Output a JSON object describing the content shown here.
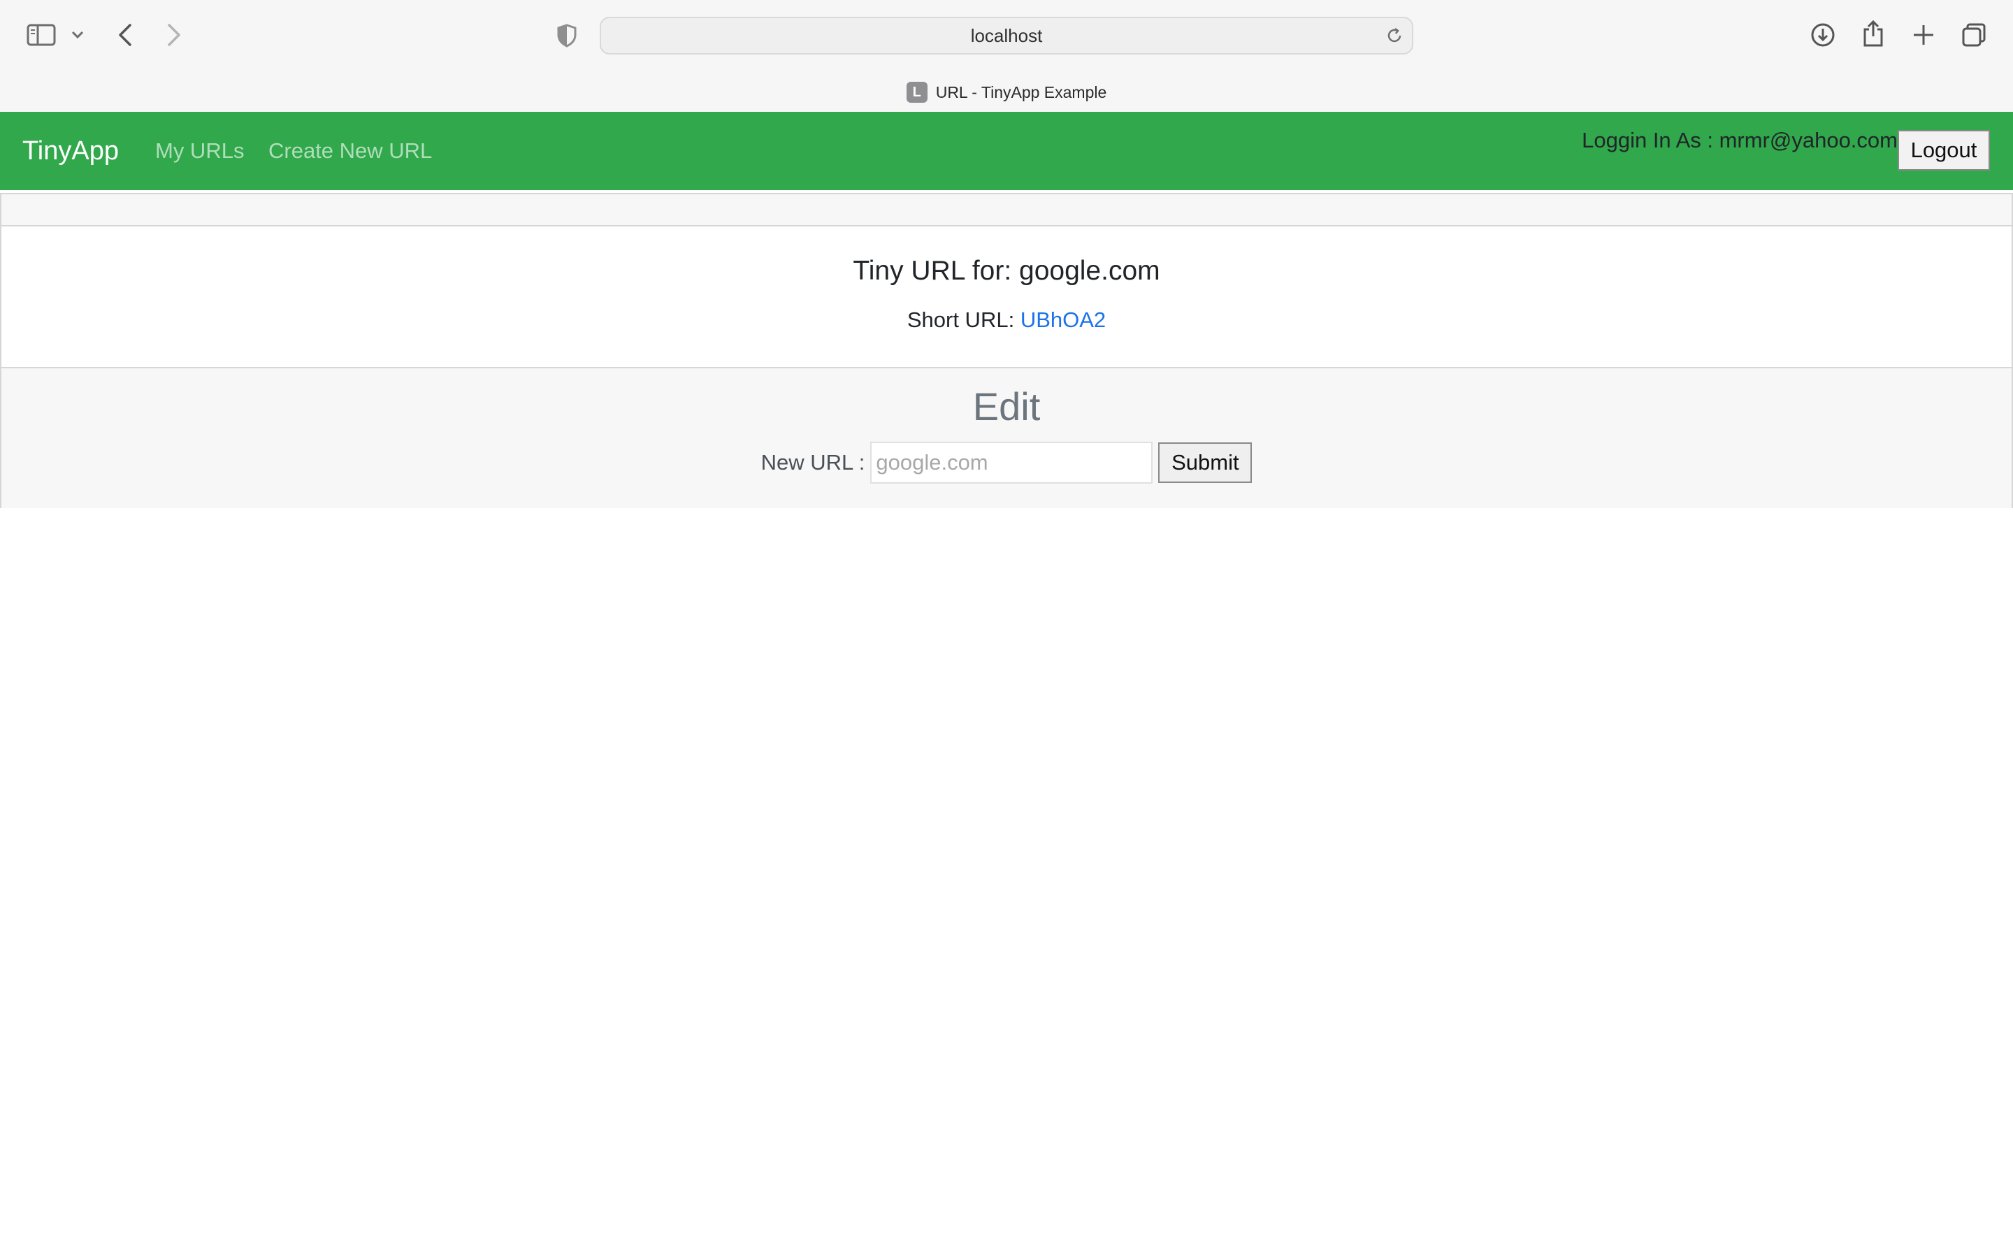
{
  "browser": {
    "address": "localhost",
    "tab_title": "URL - TinyApp Example",
    "favicon_letter": "L",
    "icons": [
      "sidebar-icon",
      "chevron-down-icon",
      "back-icon",
      "forward-icon",
      "shield-icon",
      "reload-icon",
      "download-icon",
      "share-icon",
      "new-tab-icon",
      "tabs-overview-icon"
    ]
  },
  "navbar": {
    "brand": "TinyApp",
    "links": [
      "My URLs",
      "Create New URL"
    ],
    "login_label": "Loggin In As : mrmr@yahoo.com",
    "logout_label": "Logout",
    "background_color": "#30a84b"
  },
  "card": {
    "title": "Tiny URL for: google.com",
    "short_label": "Short URL:",
    "short_code": "UBhOA2",
    "edit_title": "Edit",
    "new_url_label": "New URL :",
    "new_url_placeholder": "google.com",
    "new_url_value": "",
    "submit_label": "Submit",
    "link_color": "#1a73e8"
  }
}
